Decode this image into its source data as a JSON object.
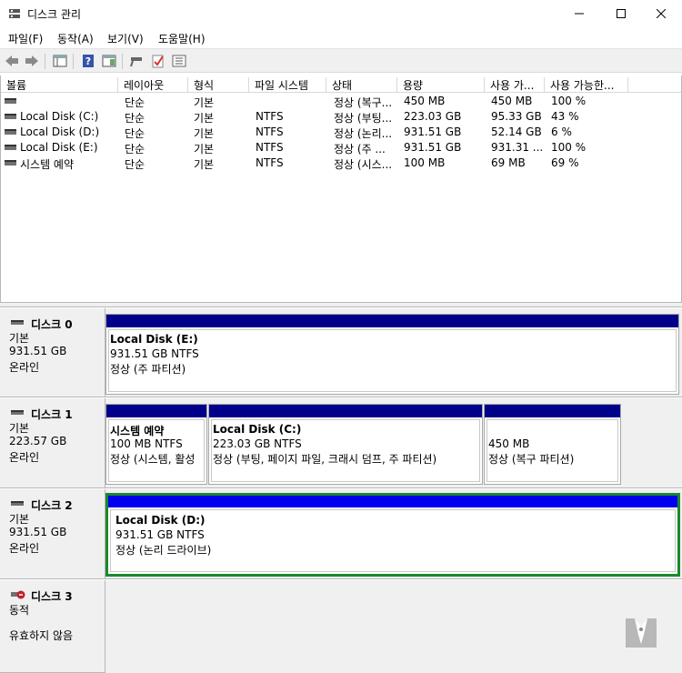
{
  "window": {
    "title": "디스크 관리"
  },
  "menu": [
    "파일(F)",
    "동작(A)",
    "보기(V)",
    "도움말(H)"
  ],
  "columns": [
    "볼륨",
    "레이아웃",
    "형식",
    "파일 시스템",
    "상태",
    "용량",
    "사용 가...",
    "사용 가능한..."
  ],
  "volumes": [
    {
      "name": "",
      "layout": "단순",
      "type": "기본",
      "fs": "",
      "status": "정상 (복구...",
      "capacity": "450 MB",
      "free": "450 MB",
      "pct": "100 %"
    },
    {
      "name": "Local Disk (C:)",
      "layout": "단순",
      "type": "기본",
      "fs": "NTFS",
      "status": "정상 (부팅...",
      "capacity": "223.03 GB",
      "free": "95.33 GB",
      "pct": "43 %"
    },
    {
      "name": "Local Disk (D:)",
      "layout": "단순",
      "type": "기본",
      "fs": "NTFS",
      "status": "정상 (논리...",
      "capacity": "931.51 GB",
      "free": "52.14 GB",
      "pct": "6 %"
    },
    {
      "name": "Local Disk (E:)",
      "layout": "단순",
      "type": "기본",
      "fs": "NTFS",
      "status": "정상 (주 ...",
      "capacity": "931.51 GB",
      "free": "931.31 ...",
      "pct": "100 %"
    },
    {
      "name": "시스템 예약",
      "layout": "단순",
      "type": "기본",
      "fs": "NTFS",
      "status": "정상 (시스...",
      "capacity": "100 MB",
      "free": "69 MB",
      "pct": "69 %"
    }
  ],
  "disks": [
    {
      "name": "디스크 0",
      "kind": "기본",
      "size": "931.51 GB",
      "state": "온라인",
      "partitions": [
        {
          "label": "Local Disk  (E:)",
          "size": "931.51 GB NTFS",
          "status": "정상 (주 파티션)"
        }
      ]
    },
    {
      "name": "디스크 1",
      "kind": "기본",
      "size": "223.57 GB",
      "state": "온라인",
      "partitions": [
        {
          "label": "시스템 예약",
          "size": "100 MB NTFS",
          "status": "정상 (시스템, 활성"
        },
        {
          "label": "Local Disk  (C:)",
          "size": "223.03 GB NTFS",
          "status": "정상 (부팅, 페이지 파일, 크래시 덤프, 주 파티션)"
        },
        {
          "label": "",
          "size": "450 MB",
          "status": "정상 (복구 파티션)"
        }
      ]
    },
    {
      "name": "디스크 2",
      "kind": "기본",
      "size": "931.51 GB",
      "state": "온라인",
      "partitions": [
        {
          "label": "Local Disk  (D:)",
          "size": "931.51 GB NTFS",
          "status": "정상 (논리 드라이브)"
        }
      ]
    },
    {
      "name": "디스크 3",
      "kind": "동적",
      "size": "",
      "state": "유효하지 않음",
      "partitions": []
    }
  ],
  "colors": {
    "primary_partition_bar": "#00008b",
    "logical_partition_bar": "#0000ee",
    "selection": "#1a8a2a"
  }
}
